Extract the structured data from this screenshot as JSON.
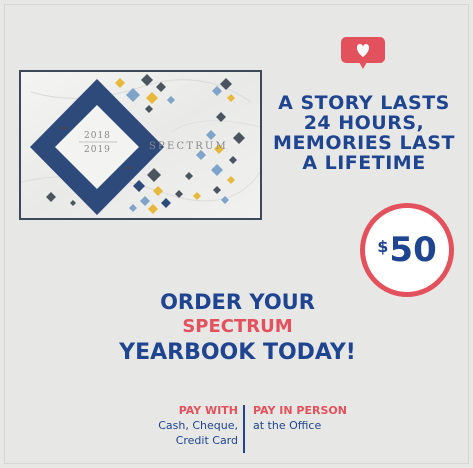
{
  "cover": {
    "year_top": "2018",
    "year_bottom": "2019",
    "title": "SPECTRUM"
  },
  "headline": {
    "lines": [
      "A STORY LASTS",
      "24 HOURS,",
      "MEMORIES LAST",
      "A LIFETIME"
    ]
  },
  "price": {
    "currency": "$",
    "amount": "50"
  },
  "order": {
    "line1": "ORDER YOUR",
    "line2": "SPECTRUM",
    "line3": "YEARBOOK TODAY!"
  },
  "payment": {
    "left_heading": "PAY WITH",
    "left_lines": [
      "Cash, Cheque,",
      "Credit Card"
    ],
    "right_heading": "PAY IN PERSON",
    "right_lines": [
      "at the Office"
    ]
  },
  "icons": {
    "like": "heart-speech-bubble-icon"
  },
  "colors": {
    "background": "#e7e7e6",
    "navy": "#1f4591",
    "coral": "#e3525c",
    "cover_navy": "#2e4a7a",
    "cover_gold": "#e8b83a",
    "cover_lightblue": "#7fa3c9",
    "cover_gray": "#4a5560"
  }
}
